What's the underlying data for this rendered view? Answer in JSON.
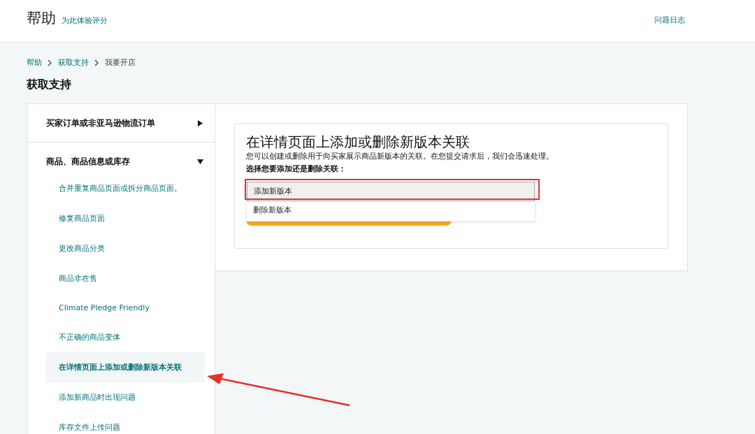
{
  "header": {
    "title": "帮助",
    "rate_link": "为此体验评分",
    "case_log_link": "问题日志"
  },
  "breadcrumb": [
    {
      "label": "帮助",
      "link": true
    },
    {
      "label": "获取支持",
      "link": true
    },
    {
      "label": "我要开店",
      "link": false
    }
  ],
  "page_title": "获取支持",
  "sidebar": {
    "sections": [
      {
        "label": "买家订单或非亚马逊物流订单",
        "expanded": false
      },
      {
        "label": "商品、商品信息或库存",
        "expanded": true,
        "items": [
          {
            "label": "合并重复商品页面或拆分商品页面。",
            "selected": false
          },
          {
            "label": "修复商品页面",
            "selected": false
          },
          {
            "label": "更改商品分类",
            "selected": false
          },
          {
            "label": "商品非在售",
            "selected": false
          },
          {
            "label": "Climate Pledge Friendly",
            "selected": false
          },
          {
            "label": "不正确的商品变体",
            "selected": false
          },
          {
            "label": "在详情页面上添加或删除新版本关联",
            "selected": true
          },
          {
            "label": "添加新商品时出现问题",
            "selected": false
          },
          {
            "label": "库存文件上传问题",
            "selected": false
          }
        ]
      }
    ]
  },
  "card": {
    "title": "在详情页面上添加或删除新版本关联",
    "description": "您可以创建或删除用于向买家展示商品新版本的关联。在您提交请求后，我们会迅速处理。",
    "question": "选择您要添加还是删除关联：",
    "options": [
      {
        "label": "添加新版本",
        "selected": true
      },
      {
        "label": "删除新版本",
        "selected": false
      }
    ]
  }
}
